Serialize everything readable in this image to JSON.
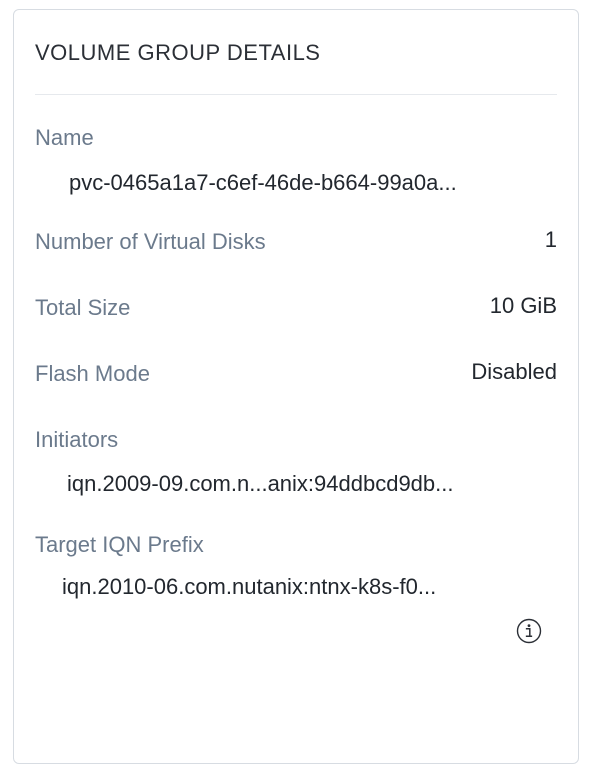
{
  "panel": {
    "title": "VOLUME GROUP DETAILS",
    "rows": [
      {
        "label": "Name",
        "value": "pvc-0465a1a7-c6ef-46de-b664-99a0a..."
      },
      {
        "label": "Number of Virtual Disks",
        "value": "1"
      },
      {
        "label": "Total Size",
        "value": "10 GiB"
      },
      {
        "label": "Flash Mode",
        "value": "Disabled"
      },
      {
        "label": "Initiators",
        "value": "iqn.2009-09.com.n...anix:94ddbcd9db..."
      },
      {
        "label": "Target IQN Prefix",
        "value": "iqn.2010-06.com.nutanix:ntnx-k8s-f0..."
      }
    ],
    "info_icon": "info-circle-icon"
  }
}
